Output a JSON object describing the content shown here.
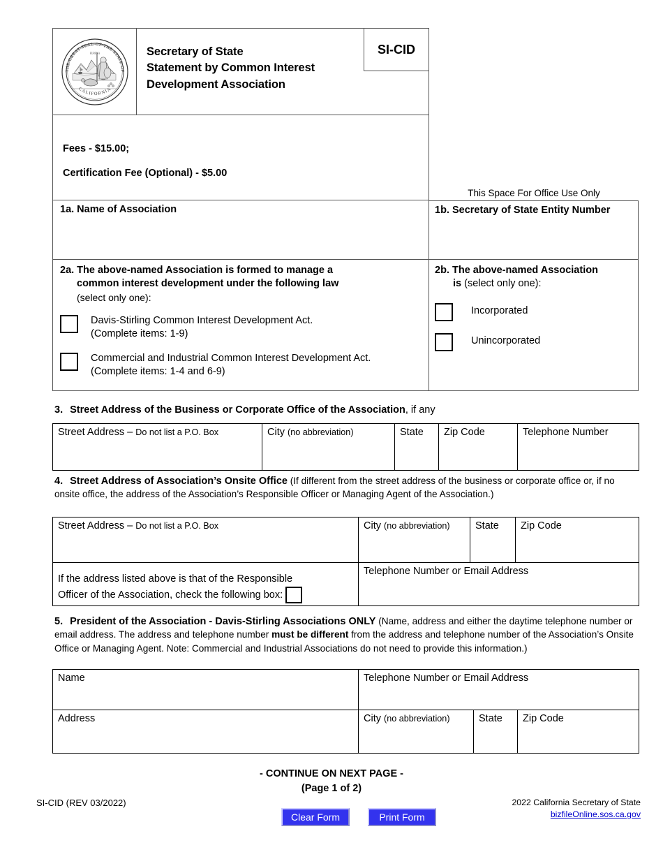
{
  "header": {
    "seal_alt": "great-seal-of-the-state-of-california",
    "title_line1": "Secretary of State",
    "title_line2": "Statement by Common Interest",
    "title_line3": "Development Association",
    "form_code": "SI-CID"
  },
  "fees": {
    "line1": "Fees - $15.00;",
    "line2": "Certification Fee (Optional) -  $5.00"
  },
  "office_use_note": "This Space For Office Use Only",
  "item1": {
    "a_label": "1a. Name of Association",
    "b_label": "1b. Secretary of State Entity Number"
  },
  "item2a": {
    "head_line1": "2a. The above-named Association is formed to manage a",
    "head_line2": "common interest development under the following law",
    "head_line3": "(select only one):",
    "options": [
      {
        "line1": "Davis-Stirling Common Interest Development Act.",
        "line2": "(Complete items: 1-9)"
      },
      {
        "line1": "Commercial and Industrial Common Interest Development Act.",
        "line2": "(Complete items: 1-4 and 6-9)"
      }
    ]
  },
  "item2b": {
    "head_line1": "2b. The above-named Association",
    "head_bold_is": "is",
    "head_rest": " (select only one):",
    "options": [
      "Incorporated",
      "Unincorporated"
    ]
  },
  "item3": {
    "number": "3.",
    "heading_bold": "Street Address of the Business or Corporate Office of the Association",
    "heading_light": ", if any",
    "columns": [
      {
        "main": "Street Address – ",
        "small": "Do not list a P.O. Box"
      },
      {
        "main": "City ",
        "small": "(no abbreviation)"
      },
      {
        "main": "State",
        "small": ""
      },
      {
        "main": "Zip Code",
        "small": ""
      },
      {
        "main": "Telephone Number",
        "small": ""
      }
    ]
  },
  "item4": {
    "number": "4.",
    "heading_bold": "Street Address of Association’s Onsite Office",
    "heading_para": " (If different from the street address of the business or corporate office or, if no onsite office, the address of the Association’s Responsible Officer or Managing Agent of the Association.)",
    "columns": [
      {
        "main": "Street Address – ",
        "small": "Do not list a P.O. Box"
      },
      {
        "main": "City ",
        "small": "(no abbreviation)"
      },
      {
        "main": "State",
        "small": ""
      },
      {
        "main": "Zip Code",
        "small": ""
      }
    ],
    "responsible_line1": "If the address listed above is that of the Responsible",
    "responsible_line2": "Officer of the Association, check the following box:",
    "contact_label": "Telephone Number or Email Address"
  },
  "item5": {
    "number": "5.",
    "heading_bold": "President of the Association - Davis-Stirling Associations ONLY",
    "para_part1": " (Name, address and either the daytime telephone number or email address. The address and telephone number ",
    "para_bold": "must be different",
    "para_part2": " from the address and telephone number of the Association’s Onsite Office or Managing Agent. Note: Commercial and Industrial Associations do not need to provide this information.)",
    "name_label": "Name",
    "contact_label": "Telephone Number or Email Address",
    "address_label": "Address",
    "city_main": "City ",
    "city_small": "(no abbreviation)",
    "state_label": "State",
    "zip_label": "Zip Code"
  },
  "footer": {
    "continue_line1": "- CONTINUE ON NEXT PAGE -",
    "continue_line2": "(Page 1 of 2)",
    "revision": "SI-CID (REV 03/2022)",
    "copyright": "2022 California Secretary of State",
    "url": "bizfileOnline.sos.ca.gov",
    "clear_button": "Clear Form",
    "print_button": "Print Form"
  },
  "colors": {
    "button_bg": "#3333ee",
    "button_text": "#ffffff",
    "link": "#0000cc",
    "border": "#000000"
  }
}
